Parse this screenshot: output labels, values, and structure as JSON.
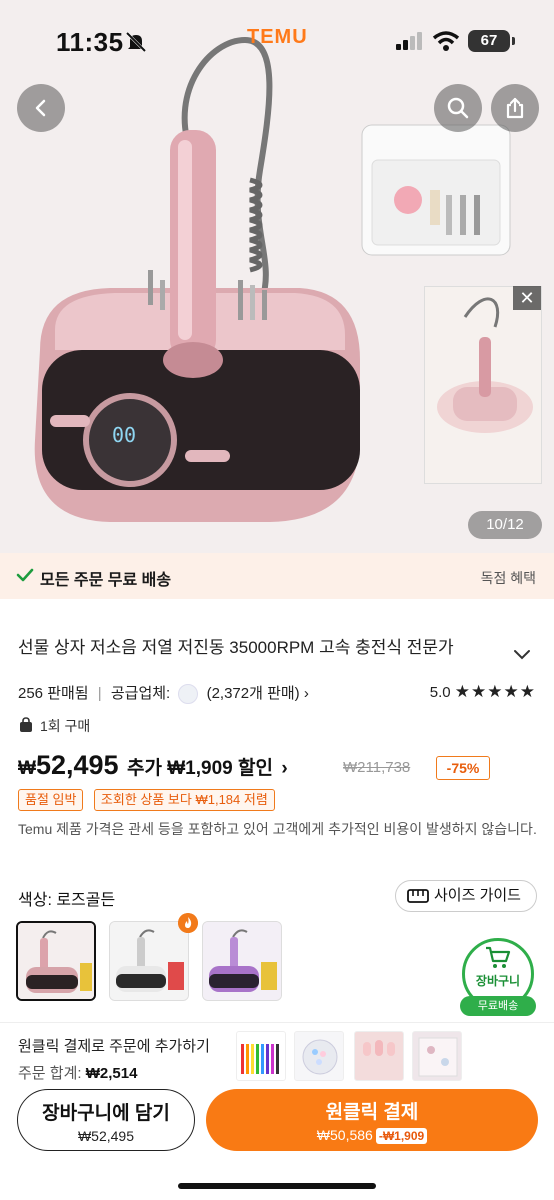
{
  "status_bar": {
    "time": "11:35",
    "brand": "TEMU",
    "battery": "67",
    "icons": [
      "bell-slash-icon",
      "signal-icon",
      "wifi-icon",
      "battery-icon"
    ]
  },
  "gallery": {
    "counter": "10/12",
    "close_label": "✕",
    "icons": [
      "back-icon",
      "search-icon",
      "share-icon"
    ]
  },
  "shipping_banner": {
    "text": "모든 주문 무료 배송",
    "right_text": "독점 혜택"
  },
  "product": {
    "title": "선물 상자 저소음 저열 저진동 35000RPM 고속 충전식 전문가",
    "sold": "256 판매됨",
    "supplier_label": "공급업체:",
    "supplier_sales": "(2,372개 판매)",
    "rating": "5.0",
    "stars": "★★★★★",
    "bought": "1회 구매",
    "price_symbol": "₩",
    "price": "52,495",
    "extra_label": "추가 ₩1,909 할인",
    "original_price": "₩211,738",
    "discount": "-75%",
    "badges": [
      "품절 임박",
      "조회한 상품 보다 ₩1,184 저렴"
    ],
    "notice": "Temu 제품 가격은 관세 등을 포함하고 있어 고객에게 추가적인 비용이 발생하지 않습니다."
  },
  "options": {
    "color_label": "색상: 로즈골든",
    "size_guide": "사이즈 가이드",
    "swatch_names": [
      "rose-gold",
      "white",
      "purple"
    ]
  },
  "floating_cart": {
    "label": "장바구니",
    "shipping": "무료배송"
  },
  "bottom": {
    "oneclick_text": "원클릭 결제로 주문에 추가하기",
    "total_label": "주문 합계:",
    "total_value": "₩2,514",
    "add_cart_label": "장바구니에 담기",
    "add_cart_price": "₩52,495",
    "buy_label": "원클릭 결제",
    "buy_price": "₩50,586",
    "buy_saving": "-₩1,909"
  },
  "colors": {
    "accent_orange": "#f97a14",
    "discount_orange": "#e85d0c",
    "cart_green": "#2fae4a",
    "banner_bg": "#fdf0e8"
  }
}
